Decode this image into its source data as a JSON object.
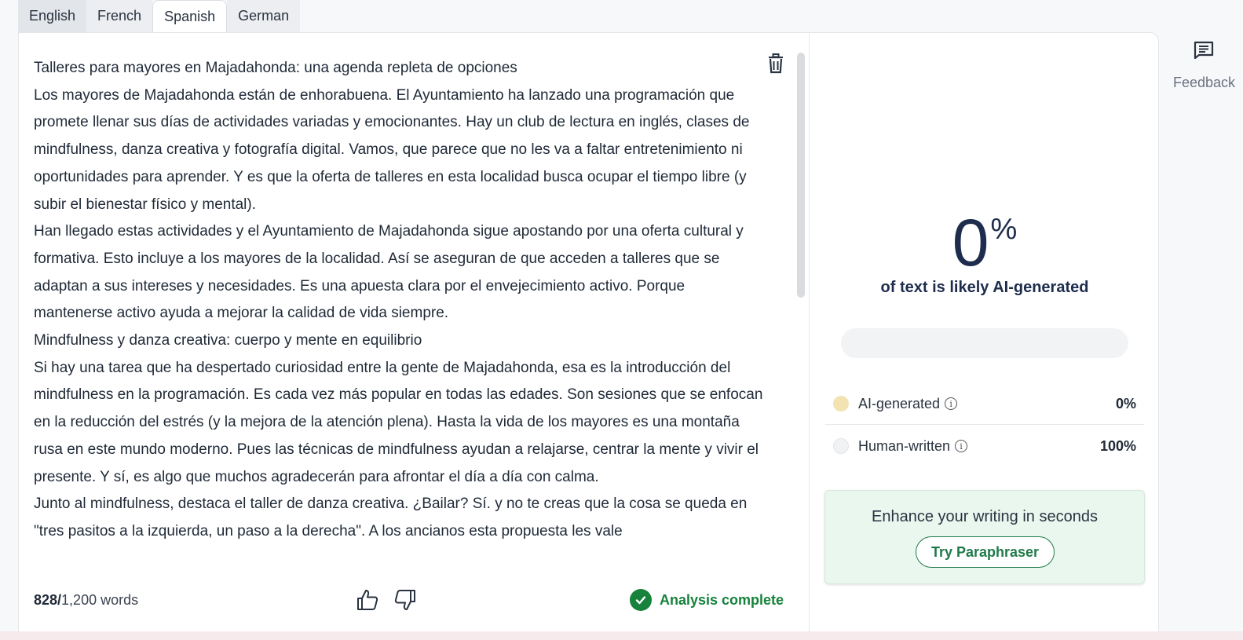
{
  "tabs": [
    {
      "label": "English"
    },
    {
      "label": "French"
    },
    {
      "label": "Spanish",
      "active": true
    },
    {
      "label": "German"
    }
  ],
  "editor": {
    "paragraphs": [
      "Talleres para mayores en Majadahonda: una agenda repleta de opciones",
      "Los mayores de Majadahonda están de enhorabuena. El Ayuntamiento ha lanzado una programación que promete llenar sus días de actividades variadas y emocionantes. Hay un club de lectura en inglés, clases de mindfulness, danza creativa y fotografía digital. Vamos, que parece que no les va a faltar entretenimiento ni oportunidades para aprender. Y es que la oferta de talleres en esta localidad busca ocupar el tiempo libre (y subir el bienestar físico y mental).",
      "Han llegado estas actividades y el Ayuntamiento de Majadahonda sigue apostando por una oferta cultural y formativa. Esto incluye a los mayores de la localidad. Así se aseguran de que acceden a talleres que se adaptan a sus intereses y necesidades. Es una apuesta clara por el envejecimiento activo. Porque mantenerse activo ayuda a mejorar la calidad de vida siempre.",
      "Mindfulness y danza creativa: cuerpo y mente en equilibrio",
      "Si hay una tarea que ha despertado curiosidad entre la gente de Majadahonda, esa es la introducción del mindfulness en la programación. Es cada vez más popular en todas las edades. Son sesiones que se enfocan en la reducción del estrés (y la mejora de la atención plena). Hasta la vida de los mayores es una montaña rusa en este mundo moderno. Pues las técnicas de mindfulness ayudan a relajarse, centrar la mente y vivir el presente. Y sí, es algo que muchos agradecerán para afrontar el día a día con calma.",
      "Junto al mindfulness, destaca el taller de danza creativa. ¿Bailar? Sí. y no te creas que la cosa se queda en \"tres pasitos a la izquierda, un paso a la derecha\". A los ancianos esta propuesta les vale"
    ]
  },
  "footer": {
    "word_count": "828/",
    "word_limit": "1,200 words",
    "status": "Analysis complete"
  },
  "results": {
    "percent": "0",
    "percent_sign": "%",
    "caption": "of text is likely AI-generated",
    "meter_fraction": 0,
    "rows": [
      {
        "label": "AI-generated",
        "value": "0%",
        "color": "#f3e3b3"
      },
      {
        "label": "Human-written",
        "value": "100%",
        "color": "#f1f2f4"
      }
    ],
    "promo_text": "Enhance your writing in seconds",
    "promo_button": "Try Paraphraser"
  },
  "sidebar": {
    "feedback_label": "Feedback"
  },
  "colors": {
    "accent_green": "#16823b",
    "heading_navy": "#1e2d4d"
  },
  "icons": [
    "trash-icon",
    "thumbs-up-icon",
    "thumbs-down-icon",
    "check-circle-icon",
    "info-icon",
    "feedback-icon"
  ]
}
